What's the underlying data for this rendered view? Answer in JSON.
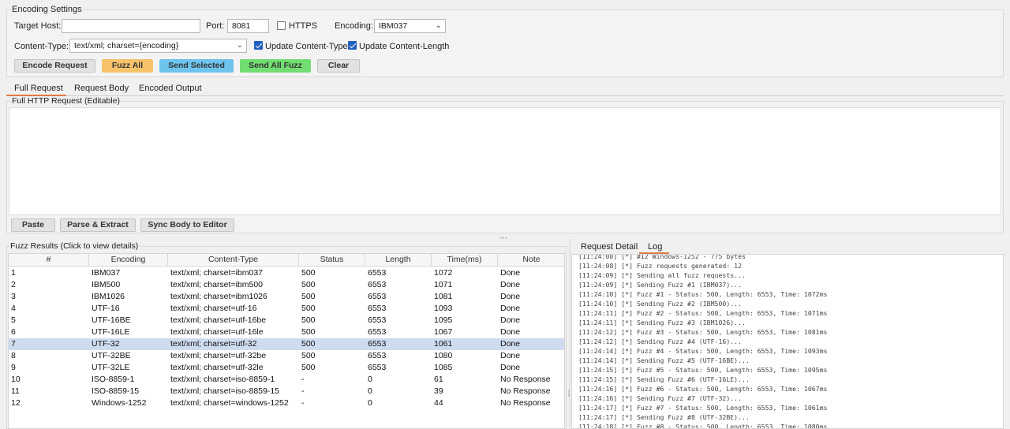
{
  "settings": {
    "title": "Encoding Settings",
    "target_host_label": "Target Host:",
    "target_host_value": "",
    "port_label": "Port:",
    "port_value": "8081",
    "https_label": "HTTPS",
    "https_checked": false,
    "encoding_label": "Encoding:",
    "encoding_value": "IBM037",
    "content_type_label": "Content-Type:",
    "content_type_value": "text/xml; charset={encoding}",
    "update_ct_label": "Update Content-Type",
    "update_ct_checked": true,
    "update_cl_label": "Update Content-Length",
    "update_cl_checked": true
  },
  "buttons": {
    "encode": "Encode Request",
    "fuzz_all": "Fuzz All",
    "send_selected": "Send Selected",
    "send_all_fuzz": "Send All Fuzz",
    "clear": "Clear",
    "paste": "Paste",
    "parse_extract": "Parse & Extract",
    "sync_body": "Sync Body to Editor"
  },
  "colors": {
    "fuzz_all": "#f7c36a",
    "send_selected": "#6fc4ee",
    "send_all_fuzz": "#72dd72",
    "tab_accent": "#e07a45",
    "selected_row": "#cfdcf0"
  },
  "tabs": [
    "Full Request",
    "Request Body",
    "Encoded Output"
  ],
  "active_tab": "Full Request",
  "request_panel": {
    "title": "Full HTTP Request (Editable)",
    "content": ""
  },
  "fuzz": {
    "title": "Fuzz Results (Click to view details)",
    "columns": [
      "#",
      "Encoding",
      "Content-Type",
      "Status",
      "Length",
      "Time(ms)",
      "Note"
    ],
    "selected_row": 7,
    "rows": [
      [
        "1",
        "IBM037",
        "text/xml; charset=ibm037",
        "500",
        "6553",
        "1072",
        "Done"
      ],
      [
        "2",
        "IBM500",
        "text/xml; charset=ibm500",
        "500",
        "6553",
        "1071",
        "Done"
      ],
      [
        "3",
        "IBM1026",
        "text/xml; charset=ibm1026",
        "500",
        "6553",
        "1081",
        "Done"
      ],
      [
        "4",
        "UTF-16",
        "text/xml; charset=utf-16",
        "500",
        "6553",
        "1093",
        "Done"
      ],
      [
        "5",
        "UTF-16BE",
        "text/xml; charset=utf-16be",
        "500",
        "6553",
        "1095",
        "Done"
      ],
      [
        "6",
        "UTF-16LE",
        "text/xml; charset=utf-16le",
        "500",
        "6553",
        "1067",
        "Done"
      ],
      [
        "7",
        "UTF-32",
        "text/xml; charset=utf-32",
        "500",
        "6553",
        "1061",
        "Done"
      ],
      [
        "8",
        "UTF-32BE",
        "text/xml; charset=utf-32be",
        "500",
        "6553",
        "1080",
        "Done"
      ],
      [
        "9",
        "UTF-32LE",
        "text/xml; charset=utf-32le",
        "500",
        "6553",
        "1085",
        "Done"
      ],
      [
        "10",
        "ISO-8859-1",
        "text/xml; charset=iso-8859-1",
        "-",
        "0",
        "61",
        "No Response"
      ],
      [
        "11",
        "ISO-8859-15",
        "text/xml; charset=iso-8859-15",
        "-",
        "0",
        "39",
        "No Response"
      ],
      [
        "12",
        "Windows-1252",
        "text/xml; charset=windows-1252",
        "-",
        "0",
        "44",
        "No Response"
      ]
    ]
  },
  "right_tabs": [
    "Request Detail",
    "Log"
  ],
  "right_active_tab": "Log",
  "log_lines": [
    "[11:24:08] [*] #12 Windows-1252 - 775 bytes",
    "[11:24:08] [*] Fuzz requests generated: 12",
    "[11:24:09] [*] Sending all fuzz requests...",
    "[11:24:09] [*] Sending Fuzz #1 (IBM037)...",
    "[11:24:10] [*] Fuzz #1 - Status: 500, Length: 6553, Time: 1072ms",
    "[11:24:10] [*] Sending Fuzz #2 (IBM500)...",
    "[11:24:11] [*] Fuzz #2 - Status: 500, Length: 6553, Time: 1071ms",
    "[11:24:11] [*] Sending Fuzz #3 (IBM1026)...",
    "[11:24:12] [*] Fuzz #3 - Status: 500, Length: 6553, Time: 1081ms",
    "[11:24:12] [*] Sending Fuzz #4 (UTF-16)...",
    "[11:24:14] [*] Fuzz #4 - Status: 500, Length: 6553, Time: 1093ms",
    "[11:24:14] [*] Sending Fuzz #5 (UTF-16BE)...",
    "[11:24:15] [*] Fuzz #5 - Status: 500, Length: 6553, Time: 1095ms",
    "[11:24:15] [*] Sending Fuzz #6 (UTF-16LE)...",
    "[11:24:16] [*] Fuzz #6 - Status: 500, Length: 6553, Time: 1067ms",
    "[11:24:16] [*] Sending Fuzz #7 (UTF-32)...",
    "[11:24:17] [*] Fuzz #7 - Status: 500, Length: 6553, Time: 1061ms",
    "[11:24:17] [*] Sending Fuzz #8 (UTF-32BE)...",
    "[11:24:18] [*] Fuzz #8 - Status: 500, Length: 6553, Time: 1080ms"
  ]
}
